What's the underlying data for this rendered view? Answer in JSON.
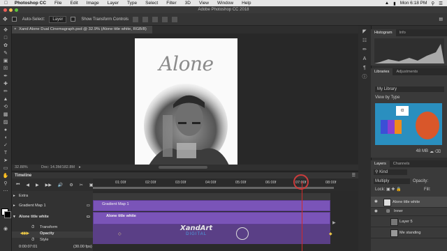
{
  "menubar": {
    "app": "Photoshop CC",
    "items": [
      "File",
      "Edit",
      "Image",
      "Layer",
      "Type",
      "Select",
      "Filter",
      "3D",
      "View",
      "Window",
      "Help"
    ],
    "clock": "Mon 6:18 PM"
  },
  "window_title": "Adobe Photoshop CC 2018",
  "options_bar": {
    "auto_select_label": "Auto-Select:",
    "auto_select_value": "Layer",
    "show_transform_label": "Show Transform Controls"
  },
  "doc_tab": "Xand Alone Dual Cinemagraph.psd @ 32.9% (Alone title white, RGB/8)",
  "canvas": {
    "poster_title": "Alone"
  },
  "status_bar": {
    "zoom": "32.88%",
    "doc_size": "Doc: 14.3M/182.8M"
  },
  "timeline": {
    "panel_label": "Timeline",
    "ruler_ticks": [
      "01:00f",
      "02:00f",
      "03:00f",
      "04:00f",
      "05:00f",
      "06:00f",
      "07:00f",
      "08:00f"
    ],
    "current_time": "0:00:07:01",
    "fps": "(30.00 fps)",
    "tracks": [
      {
        "name": "Extra"
      },
      {
        "name": "Gradient Map 1",
        "clip": "Gradient Map 1"
      },
      {
        "name": "Alone title white",
        "clip": "Alone title white"
      }
    ],
    "properties": [
      "Transform",
      "Opacity",
      "Style"
    ],
    "watermark_brand": "XandArt",
    "watermark_sub": "DIGITAL"
  },
  "panels": {
    "histogram_tabs": [
      "Histogram",
      "Info"
    ],
    "libraries_tabs": [
      "Libraries",
      "Adjustments"
    ],
    "library_name": "My Library",
    "library_view": "View by Type",
    "library_storage": "48 MB",
    "layers_tabs": [
      "Layers",
      "Channels"
    ],
    "kind_label": "Kind",
    "blend_mode": "Multiply",
    "opacity_label": "Opacity:",
    "fill_label": "Fill:",
    "lock_label": "Lock:",
    "layers": [
      {
        "name": "Alone title white"
      },
      {
        "name": "Inner"
      },
      {
        "name": "Layer 5"
      },
      {
        "name": "Me standing"
      }
    ]
  }
}
